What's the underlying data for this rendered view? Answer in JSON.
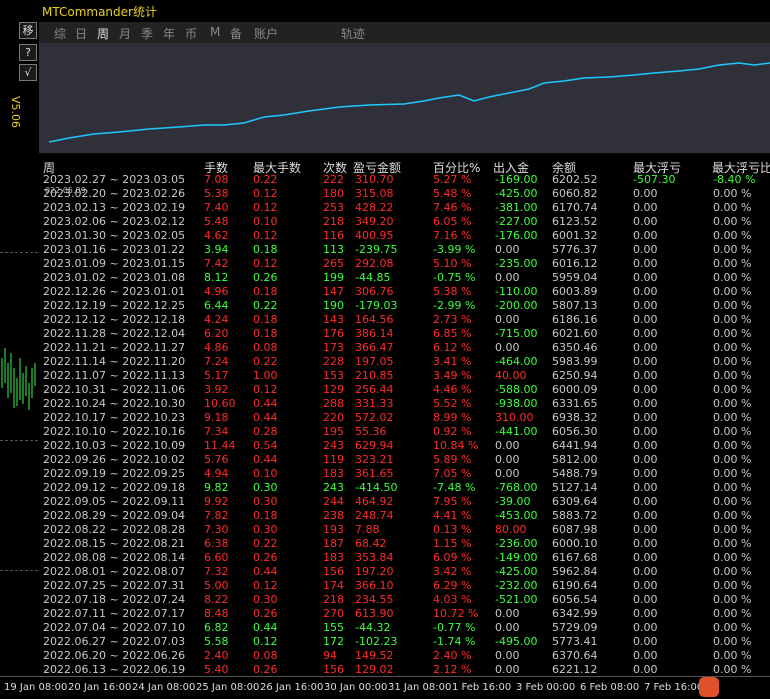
{
  "window": {
    "title": "MTCommander统计"
  },
  "tabs": [
    "综",
    "日",
    "周",
    "月",
    "季",
    "年",
    "币",
    "M",
    "备",
    "账户",
    "轨迹"
  ],
  "active_tab": "周",
  "side": {
    "buttons": [
      "移",
      "?",
      "√"
    ],
    "label": "V5.06"
  },
  "curve": {
    "start_date": "022.05.09"
  },
  "headers": [
    "周",
    "手数",
    "最大手数",
    "次数",
    "盈亏金额",
    "百分比%",
    "出入金",
    "余额",
    "最大浮亏",
    "最大浮亏比"
  ],
  "rows": [
    {
      "week": "2023.02.27 ~ 2023.03.05",
      "lots": "7.08",
      "max": "0.22",
      "cnt": "222",
      "pl": "310.70",
      "pct": "5.27 %",
      "flow": "-169.00",
      "bal": "6202.52",
      "fl": "-507.30",
      "flp": "-8.40 %",
      "pos": true
    },
    {
      "week": "2023.02.20 ~ 2023.02.26",
      "lots": "5.38",
      "max": "0.12",
      "cnt": "180",
      "pl": "315.08",
      "pct": "5.48 %",
      "flow": "-425.00",
      "bal": "6060.82",
      "fl": "0.00",
      "flp": "0.00 %",
      "pos": true
    },
    {
      "week": "2023.02.13 ~ 2023.02.19",
      "lots": "7.40",
      "max": "0.12",
      "cnt": "253",
      "pl": "428.22",
      "pct": "7.46 %",
      "flow": "-381.00",
      "bal": "6170.74",
      "fl": "0.00",
      "flp": "0.00 %",
      "pos": true
    },
    {
      "week": "2023.02.06 ~ 2023.02.12",
      "lots": "5.48",
      "max": "0.10",
      "cnt": "218",
      "pl": "349.20",
      "pct": "6.05 %",
      "flow": "-227.00",
      "bal": "6123.52",
      "fl": "0.00",
      "flp": "0.00 %",
      "pos": true
    },
    {
      "week": "2023.01.30 ~ 2023.02.05",
      "lots": "4.62",
      "max": "0.12",
      "cnt": "116",
      "pl": "400.95",
      "pct": "7.16 %",
      "flow": "-176.00",
      "bal": "6001.32",
      "fl": "0.00",
      "flp": "0.00 %",
      "pos": true
    },
    {
      "week": "2023.01.16 ~ 2023.01.22",
      "lots": "3.94",
      "max": "0.18",
      "cnt": "113",
      "pl": "-239.75",
      "pct": "-3.99 %",
      "flow": "0.00",
      "bal": "5776.37",
      "fl": "0.00",
      "flp": "0.00 %",
      "pos": false
    },
    {
      "week": "2023.01.09 ~ 2023.01.15",
      "lots": "7.42",
      "max": "0.12",
      "cnt": "265",
      "pl": "292.08",
      "pct": "5.10 %",
      "flow": "-235.00",
      "bal": "6016.12",
      "fl": "0.00",
      "flp": "0.00 %",
      "pos": true
    },
    {
      "week": "2023.01.02 ~ 2023.01.08",
      "lots": "8.12",
      "max": "0.26",
      "cnt": "199",
      "pl": "-44.85",
      "pct": "-0.75 %",
      "flow": "0.00",
      "bal": "5959.04",
      "fl": "0.00",
      "flp": "0.00 %",
      "pos": false
    },
    {
      "week": "2022.12.26 ~ 2023.01.01",
      "lots": "4.96",
      "max": "0.18",
      "cnt": "147",
      "pl": "306.76",
      "pct": "5.38 %",
      "flow": "-110.00",
      "bal": "6003.89",
      "fl": "0.00",
      "flp": "0.00 %",
      "pos": true
    },
    {
      "week": "2022.12.19 ~ 2022.12.25",
      "lots": "6.44",
      "max": "0.22",
      "cnt": "190",
      "pl": "-179.03",
      "pct": "-2.99 %",
      "flow": "-200.00",
      "bal": "5807.13",
      "fl": "0.00",
      "flp": "0.00 %",
      "pos": false
    },
    {
      "week": "2022.12.12 ~ 2022.12.18",
      "lots": "4.24",
      "max": "0.18",
      "cnt": "143",
      "pl": "164.56",
      "pct": "2.73 %",
      "flow": "0.00",
      "bal": "6186.16",
      "fl": "0.00",
      "flp": "0.00 %",
      "pos": true
    },
    {
      "week": "2022.11.28 ~ 2022.12.04",
      "lots": "6.20",
      "max": "0.18",
      "cnt": "176",
      "pl": "386.14",
      "pct": "6.85 %",
      "flow": "-715.00",
      "bal": "6021.60",
      "fl": "0.00",
      "flp": "0.00 %",
      "pos": true
    },
    {
      "week": "2022.11.21 ~ 2022.11.27",
      "lots": "4.86",
      "max": "0.08",
      "cnt": "173",
      "pl": "366.47",
      "pct": "6.12 %",
      "flow": "0.00",
      "bal": "6350.46",
      "fl": "0.00",
      "flp": "0.00 %",
      "pos": true
    },
    {
      "week": "2022.11.14 ~ 2022.11.20",
      "lots": "7.24",
      "max": "0.22",
      "cnt": "228",
      "pl": "197.05",
      "pct": "3.41 %",
      "flow": "-464.00",
      "bal": "5983.99",
      "fl": "0.00",
      "flp": "0.00 %",
      "pos": true
    },
    {
      "week": "2022.11.07 ~ 2022.11.13",
      "lots": "5.17",
      "max": "1.00",
      "cnt": "153",
      "pl": "210.85",
      "pct": "3.49 %",
      "flow": "40.00",
      "bal": "6250.94",
      "fl": "0.00",
      "flp": "0.00 %",
      "pos": true
    },
    {
      "week": "2022.10.31 ~ 2022.11.06",
      "lots": "3.92",
      "max": "0.12",
      "cnt": "129",
      "pl": "256.44",
      "pct": "4.46 %",
      "flow": "-588.00",
      "bal": "6000.09",
      "fl": "0.00",
      "flp": "0.00 %",
      "pos": true
    },
    {
      "week": "2022.10.24 ~ 2022.10.30",
      "lots": "10.60",
      "max": "0.44",
      "cnt": "288",
      "pl": "331.33",
      "pct": "5.52 %",
      "flow": "-938.00",
      "bal": "6331.65",
      "fl": "0.00",
      "flp": "0.00 %",
      "pos": true
    },
    {
      "week": "2022.10.17 ~ 2022.10.23",
      "lots": "9.18",
      "max": "0.44",
      "cnt": "220",
      "pl": "572.02",
      "pct": "8.99 %",
      "flow": "310.00",
      "bal": "6938.32",
      "fl": "0.00",
      "flp": "0.00 %",
      "pos": true
    },
    {
      "week": "2022.10.10 ~ 2022.10.16",
      "lots": "7.34",
      "max": "0.28",
      "cnt": "195",
      "pl": "55.36",
      "pct": "0.92 %",
      "flow": "-441.00",
      "bal": "6056.30",
      "fl": "0.00",
      "flp": "0.00 %",
      "pos": true
    },
    {
      "week": "2022.10.03 ~ 2022.10.09",
      "lots": "11.44",
      "max": "0.54",
      "cnt": "243",
      "pl": "629.94",
      "pct": "10.84 %",
      "flow": "0.00",
      "bal": "6441.94",
      "fl": "0.00",
      "flp": "0.00 %",
      "pos": true
    },
    {
      "week": "2022.09.26 ~ 2022.10.02",
      "lots": "5.76",
      "max": "0.44",
      "cnt": "119",
      "pl": "323.21",
      "pct": "5.89 %",
      "flow": "0.00",
      "bal": "5812.00",
      "fl": "0.00",
      "flp": "0.00 %",
      "pos": true
    },
    {
      "week": "2022.09.19 ~ 2022.09.25",
      "lots": "4.94",
      "max": "0.10",
      "cnt": "183",
      "pl": "361.65",
      "pct": "7.05 %",
      "flow": "0.00",
      "bal": "5488.79",
      "fl": "0.00",
      "flp": "0.00 %",
      "pos": true
    },
    {
      "week": "2022.09.12 ~ 2022.09.18",
      "lots": "9.82",
      "max": "0.30",
      "cnt": "243",
      "pl": "-414.50",
      "pct": "-7.48 %",
      "flow": "-768.00",
      "bal": "5127.14",
      "fl": "0.00",
      "flp": "0.00 %",
      "pos": false
    },
    {
      "week": "2022.09.05 ~ 2022.09.11",
      "lots": "9.92",
      "max": "0.30",
      "cnt": "244",
      "pl": "464.92",
      "pct": "7.95 %",
      "flow": "-39.00",
      "bal": "6309.64",
      "fl": "0.00",
      "flp": "0.00 %",
      "pos": true
    },
    {
      "week": "2022.08.29 ~ 2022.09.04",
      "lots": "7.82",
      "max": "0.18",
      "cnt": "238",
      "pl": "248.74",
      "pct": "4.41 %",
      "flow": "-453.00",
      "bal": "5883.72",
      "fl": "0.00",
      "flp": "0.00 %",
      "pos": true
    },
    {
      "week": "2022.08.22 ~ 2022.08.28",
      "lots": "7.30",
      "max": "0.30",
      "cnt": "193",
      "pl": "7.88",
      "pct": "0.13 %",
      "flow": "80.00",
      "bal": "6087.98",
      "fl": "0.00",
      "flp": "0.00 %",
      "pos": true
    },
    {
      "week": "2022.08.15 ~ 2022.08.21",
      "lots": "6.38",
      "max": "0.22",
      "cnt": "187",
      "pl": "68.42",
      "pct": "1.15 %",
      "flow": "-236.00",
      "bal": "6000.10",
      "fl": "0.00",
      "flp": "0.00 %",
      "pos": true
    },
    {
      "week": "2022.08.08 ~ 2022.08.14",
      "lots": "6.60",
      "max": "0.26",
      "cnt": "183",
      "pl": "353.84",
      "pct": "6.09 %",
      "flow": "-149.00",
      "bal": "6167.68",
      "fl": "0.00",
      "flp": "0.00 %",
      "pos": true
    },
    {
      "week": "2022.08.01 ~ 2022.08.07",
      "lots": "7.32",
      "max": "0.44",
      "cnt": "156",
      "pl": "197.20",
      "pct": "3.42 %",
      "flow": "-425.00",
      "bal": "5962.84",
      "fl": "0.00",
      "flp": "0.00 %",
      "pos": true
    },
    {
      "week": "2022.07.25 ~ 2022.07.31",
      "lots": "5.00",
      "max": "0.12",
      "cnt": "174",
      "pl": "366.10",
      "pct": "6.29 %",
      "flow": "-232.00",
      "bal": "6190.64",
      "fl": "0.00",
      "flp": "0.00 %",
      "pos": true
    },
    {
      "week": "2022.07.18 ~ 2022.07.24",
      "lots": "8.22",
      "max": "0.30",
      "cnt": "218",
      "pl": "234.55",
      "pct": "4.03 %",
      "flow": "-521.00",
      "bal": "6056.54",
      "fl": "0.00",
      "flp": "0.00 %",
      "pos": true
    },
    {
      "week": "2022.07.11 ~ 2022.07.17",
      "lots": "8.48",
      "max": "0.26",
      "cnt": "270",
      "pl": "613.90",
      "pct": "10.72 %",
      "flow": "0.00",
      "bal": "6342.99",
      "fl": "0.00",
      "flp": "0.00 %",
      "pos": true
    },
    {
      "week": "2022.07.04 ~ 2022.07.10",
      "lots": "6.82",
      "max": "0.44",
      "cnt": "155",
      "pl": "-44.32",
      "pct": "-0.77 %",
      "flow": "0.00",
      "bal": "5729.09",
      "fl": "0.00",
      "flp": "0.00 %",
      "pos": false
    },
    {
      "week": "2022.06.27 ~ 2022.07.03",
      "lots": "5.58",
      "max": "0.12",
      "cnt": "172",
      "pl": "-102.23",
      "pct": "-1.74 %",
      "flow": "-495.00",
      "bal": "5773.41",
      "fl": "0.00",
      "flp": "0.00 %",
      "pos": false
    },
    {
      "week": "2022.06.20 ~ 2022.06.26",
      "lots": "2.40",
      "max": "0.08",
      "cnt": "94",
      "pl": "149.52",
      "pct": "2.40 %",
      "flow": "0.00",
      "bal": "6370.64",
      "fl": "0.00",
      "flp": "0.00 %",
      "pos": true
    },
    {
      "week": "2022.06.13 ~ 2022.06.19",
      "lots": "5.40",
      "max": "0.26",
      "cnt": "156",
      "pl": "129.02",
      "pct": "2.12 %",
      "flow": "0.00",
      "bal": "6221.12",
      "fl": "0.00",
      "flp": "0.00 %",
      "pos": true
    }
  ],
  "axis_labels": [
    "19 Jan 08:00",
    "20 Jan 16:00",
    "24 Jan 08:00",
    "25 Jan 08:00",
    "26 Jan 16:00",
    "30 Jan 00:00",
    "31 Jan 08:00",
    "1 Feb 16:00",
    "3 Feb 00:00",
    "6 Feb 08:00",
    "7 Feb 16:00"
  ],
  "colors": {
    "positive": "#ff2a2a",
    "negative": "#3cff3c",
    "curve": "#1ec8ff",
    "title": "#e8d020"
  }
}
